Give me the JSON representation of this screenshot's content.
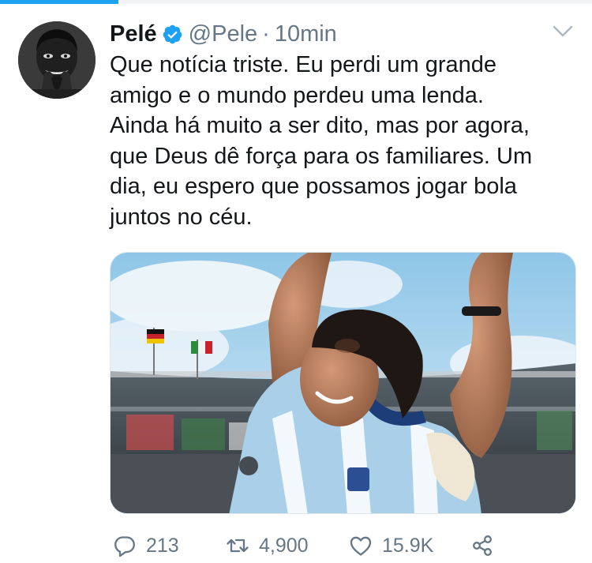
{
  "tweet": {
    "author_name": "Pelé",
    "handle": "@Pele",
    "separator": "·",
    "time": "10min",
    "text_lines": [
      "Que notícia triste. Eu perdi um grande",
      "amigo e o mundo perdeu uma lenda.",
      "Ainda há muito a ser dito, mas por agora,",
      "que Deus dê força para os familiares. Um",
      "dia, eu espero que possamos jogar bola",
      "juntos no céu."
    ]
  },
  "actions": {
    "reply_count": "213",
    "retweet_count": "4,900",
    "like_count": "15.9K"
  },
  "icons": {
    "verified": "verified-badge-icon",
    "menu": "chevron-down-icon",
    "reply": "reply-bubble-icon",
    "retweet": "retweet-icon",
    "like": "heart-icon",
    "share": "share-icon"
  },
  "colors": {
    "accent": "#1da1f2",
    "text": "#14171a",
    "secondary": "#657786"
  }
}
